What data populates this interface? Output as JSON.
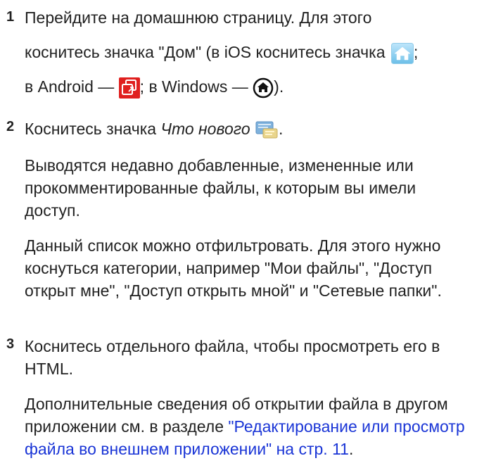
{
  "steps": [
    {
      "number": "1",
      "line1": "Перейдите на домашнюю страницу. Для этого",
      "line2_pre": "коснитесь значка \"Дом\" (в iOS коснитесь значка ",
      "line2_post": ";",
      "line3_pre": "в Android — ",
      "line3_mid": "; в Windows — ",
      "line3_post": ")."
    },
    {
      "number": "2",
      "text_pre": "Коснитесь значка ",
      "text_em": "Что нового",
      "text_post": ".",
      "para1": "Выводятся недавно добавленные, измененные или прокомментированные файлы, к которым вы имели доступ.",
      "para2": "Данный список можно отфильтровать. Для этого нужно коснуться категории, например \"Мои файлы\", \"Доступ открыт мне\", \"Доступ открыть мной\" и \"Сетевые папки\"."
    },
    {
      "number": "3",
      "text": "Коснитесь отдельного файла, чтобы просмотреть его в HTML.",
      "para_pre": "Дополнительные сведения об открытии файла в другом приложении см. в разделе ",
      "link": "\"Редактирование или просмотр файла во внешнем приложении\" на стр. 11",
      "para_post": "."
    }
  ],
  "colors": {
    "link": "#1a35d6",
    "text": "#222222"
  },
  "icons": {
    "ios_home": "home-icon",
    "android_home": "android-home-icon",
    "windows_home": "windows-home-icon",
    "whats_new": "whats-new-icon"
  }
}
